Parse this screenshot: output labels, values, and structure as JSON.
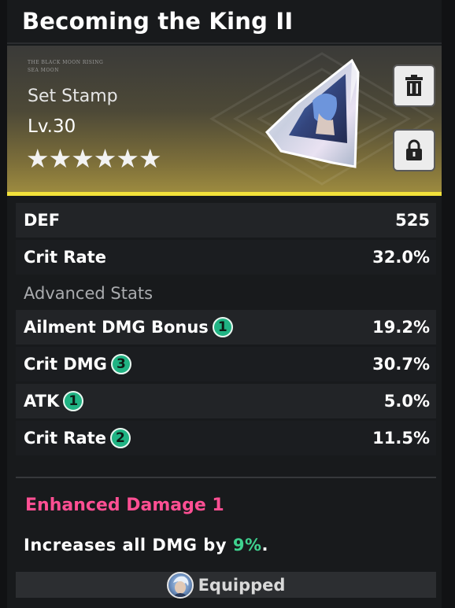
{
  "title": "Becoming the King II",
  "banner": {
    "tiny_line1": "THE BLACK MOON RISING",
    "tiny_line2": "SEA MOON",
    "stamp_type": "Set Stamp",
    "level": "Lv.30",
    "stars": [
      "★",
      "★",
      "★",
      "★",
      "★",
      "★"
    ],
    "star_count": 6,
    "buttons": {
      "trash": "trash-icon",
      "lock": "lock-icon"
    }
  },
  "stats": {
    "main": [
      {
        "label": "DEF",
        "value": "525"
      },
      {
        "label": "Crit Rate",
        "value": "32.0%"
      }
    ],
    "advanced_heading": "Advanced Stats",
    "advanced": [
      {
        "label": "Ailment DMG Bonus",
        "badge": "1",
        "value": "19.2%"
      },
      {
        "label": "Crit DMG",
        "badge": "3",
        "value": "30.7%"
      },
      {
        "label": "ATK",
        "badge": "1",
        "value": "5.0%"
      },
      {
        "label": "Crit Rate",
        "badge": "2",
        "value": "11.5%"
      }
    ]
  },
  "set_effect": {
    "name": "Enhanced Damage 1",
    "desc_prefix": "Increases all DMG by ",
    "desc_value": "9%",
    "desc_suffix": "."
  },
  "equipped": {
    "label": "Equipped"
  },
  "colors": {
    "accent_yellow": "#f2e13a",
    "badge_green": "#20b383",
    "set_name_pink": "#ff4f93",
    "highlight_green": "#3fd28f"
  }
}
